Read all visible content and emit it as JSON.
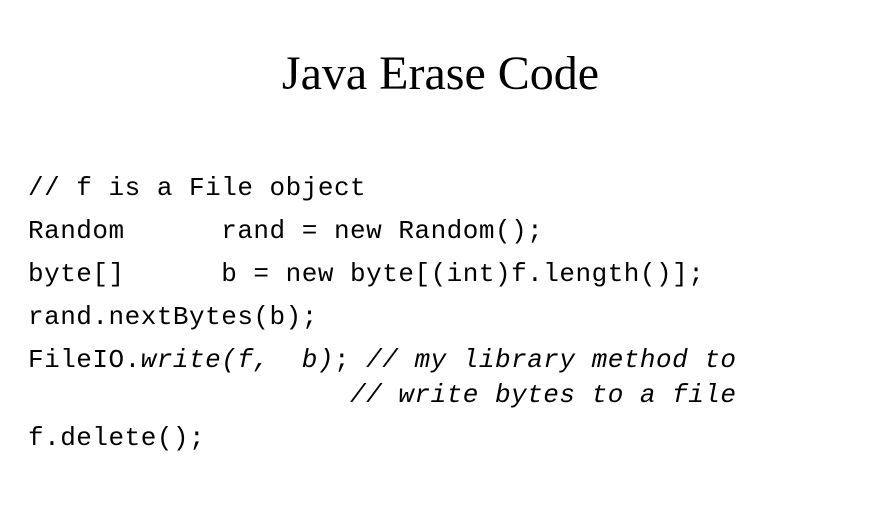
{
  "slide": {
    "title": "Java Erase Code"
  },
  "code": {
    "line1": "// f is a File object",
    "line2": "Random      rand = new Random();",
    "line3": "byte[]      b = new byte[(int)f.length()];",
    "line4": "rand.nextBytes(b);",
    "line5_normal": "FileIO.",
    "line5_italic": "write(f,  b)",
    "line5_semicolon": ";",
    "line5_comment": " // my library method to",
    "line6": "                    // write bytes to a file",
    "line7": "f.delete();"
  }
}
